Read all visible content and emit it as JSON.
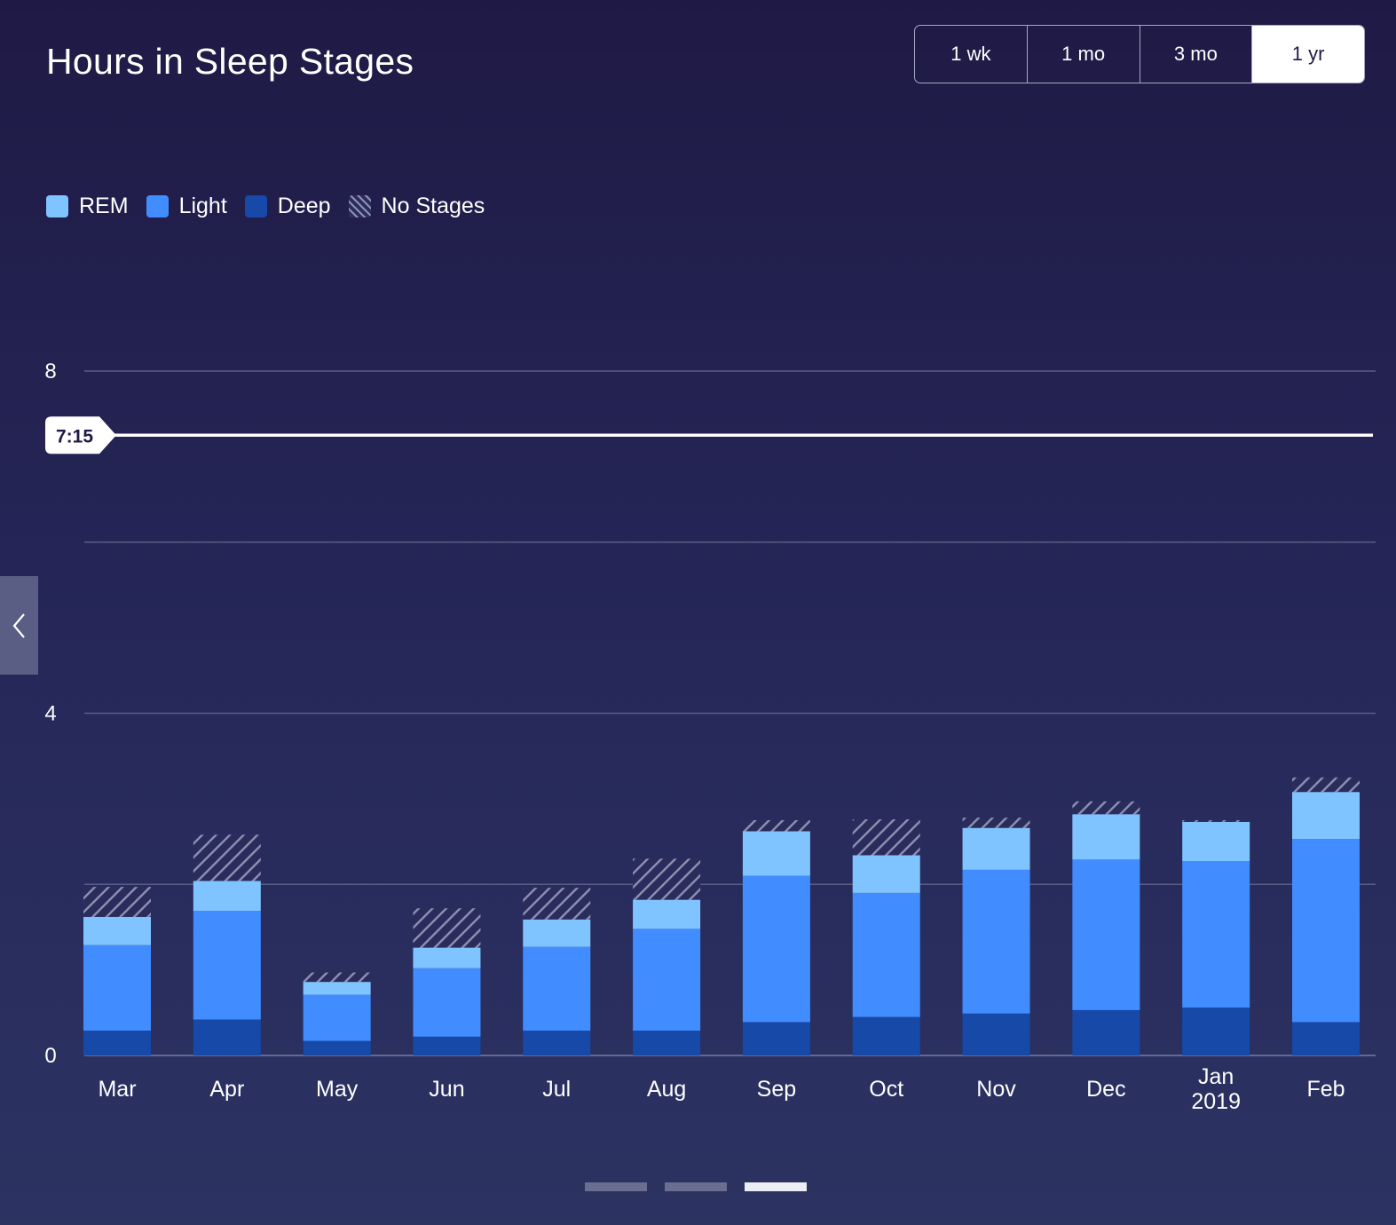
{
  "header": {
    "title": "Hours in Sleep Stages"
  },
  "range_buttons": [
    {
      "label": "1 wk",
      "active": false
    },
    {
      "label": "1 mo",
      "active": false
    },
    {
      "label": "3 mo",
      "active": false
    },
    {
      "label": "1 yr",
      "active": true
    }
  ],
  "legend": [
    {
      "label": "REM",
      "color": "#80c4ff"
    },
    {
      "label": "Light",
      "color": "#418cff"
    },
    {
      "label": "Deep",
      "color": "#1649a8"
    },
    {
      "label": "No Stages",
      "color": "hatched"
    }
  ],
  "chart_data": {
    "type": "bar",
    "stacked": true,
    "categories": [
      "Mar",
      "Apr",
      "May",
      "Jun",
      "Jul",
      "Aug",
      "Sep",
      "Oct",
      "Nov",
      "Dec",
      "Jan 2019",
      "Feb"
    ],
    "category_labels": [
      [
        "Mar"
      ],
      [
        "Apr"
      ],
      [
        "May"
      ],
      [
        "Jun"
      ],
      [
        "Jul"
      ],
      [
        "Aug"
      ],
      [
        "Sep"
      ],
      [
        "Oct"
      ],
      [
        "Nov"
      ],
      [
        "Dec"
      ],
      [
        "Jan",
        "2019"
      ],
      [
        "Feb"
      ]
    ],
    "series": [
      {
        "name": "Deep",
        "color": "#1649a8",
        "values": [
          0.29,
          0.42,
          0.17,
          0.22,
          0.29,
          0.29,
          0.39,
          0.45,
          0.49,
          0.53,
          0.56,
          0.39
        ]
      },
      {
        "name": "Light",
        "color": "#418cff",
        "values": [
          1.0,
          1.27,
          0.54,
          0.8,
          0.98,
          1.19,
          1.71,
          1.45,
          1.68,
          1.76,
          1.71,
          2.14
        ]
      },
      {
        "name": "REM",
        "color": "#80c4ff",
        "values": [
          0.33,
          0.35,
          0.15,
          0.24,
          0.32,
          0.34,
          0.52,
          0.44,
          0.49,
          0.53,
          0.46,
          0.55
        ]
      },
      {
        "name": "No Stages",
        "color": "hatched",
        "values": [
          0.35,
          0.54,
          0.11,
          0.46,
          0.37,
          0.48,
          0.13,
          0.42,
          0.12,
          0.15,
          0.02,
          0.17
        ]
      }
    ],
    "yticks": [
      0,
      4,
      8
    ],
    "ylim": [
      0,
      8
    ],
    "gridlines": [
      0,
      2,
      4,
      6,
      8
    ],
    "grid": true,
    "legend_position": "top-left",
    "goal": {
      "value": 7.25,
      "label": "7:15"
    }
  },
  "pager": {
    "count": 3,
    "active_index": 2
  }
}
